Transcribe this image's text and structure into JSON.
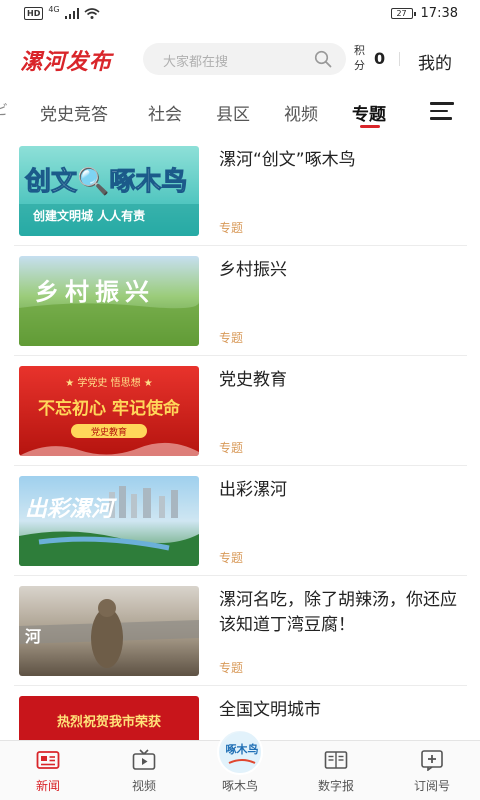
{
  "status_bar": {
    "network": "HD",
    "signal_type": "4G",
    "battery": "27",
    "time": "17:38"
  },
  "header": {
    "logo": "漯河发布",
    "search_placeholder": "大家都在搜",
    "points_label": "积分",
    "points_value": "0",
    "mine_label": "我的"
  },
  "tabs": [
    {
      "label": "党史竞答",
      "active": false
    },
    {
      "label": "社会",
      "active": false
    },
    {
      "label": "县区",
      "active": false
    },
    {
      "label": "视频",
      "active": false
    },
    {
      "label": "专题",
      "active": true
    }
  ],
  "articles": [
    {
      "title": "漯河“创文”啄木鸟",
      "tag": "专题",
      "thumb_text": "创文🔍啄木鸟",
      "thumb_subtext": "创建文明城 人人有责"
    },
    {
      "title": "乡村振兴",
      "tag": "专题",
      "thumb_text": "乡村振兴"
    },
    {
      "title": "党史教育",
      "tag": "专题",
      "thumb_text": "不忘初心 牢记使命",
      "thumb_subtext": "★ 学党史 悟思想 ★",
      "thumb_badge": "党史教育"
    },
    {
      "title": "出彩漯河",
      "tag": "专题",
      "thumb_text": "出彩漯河"
    },
    {
      "title": "漯河名吃，除了胡辣汤，你还应该知道丁湾豆腐！",
      "tag": "专题",
      "thumb_text": "河 故"
    },
    {
      "title": "全国文明城市",
      "tag": "",
      "thumb_text": "热烈祝贺我市荣获"
    }
  ],
  "bottom_nav": [
    {
      "label": "新闻",
      "icon": "news-icon",
      "active": true
    },
    {
      "label": "视频",
      "icon": "video-icon",
      "active": false
    },
    {
      "label": "啄木鸟",
      "icon": "woodpecker-icon",
      "active": false,
      "icon_text": "啄木鸟"
    },
    {
      "label": "数字报",
      "icon": "newspaper-icon",
      "active": false
    },
    {
      "label": "订阅号",
      "icon": "subscribe-icon",
      "active": false
    }
  ],
  "colors": {
    "brand_red": "#d9252a",
    "tag_orange": "#d89a5a"
  }
}
